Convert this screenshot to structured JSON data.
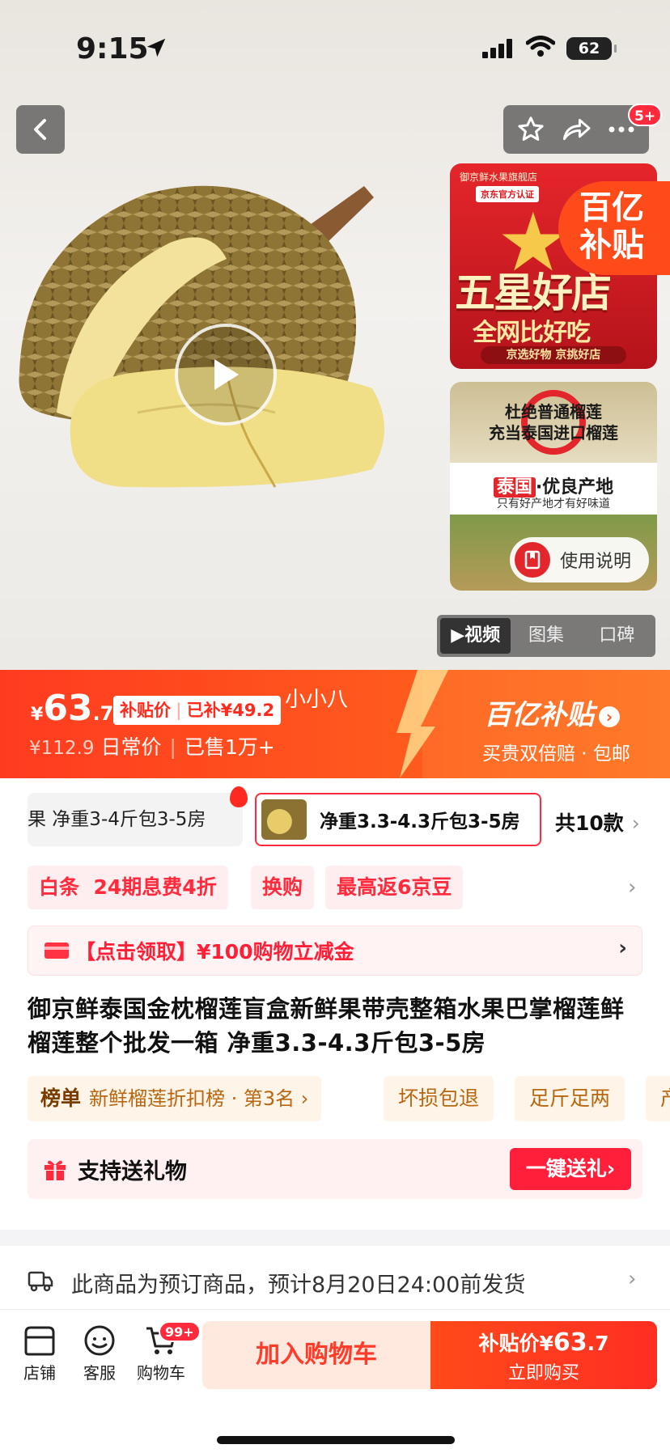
{
  "status_bar": {
    "time": "9:15",
    "battery": "62"
  },
  "top_actions": {
    "more_badge": "5+"
  },
  "promo_store": {
    "store_name": "御京鲜水果旗舰店",
    "cert": "京东官方认证",
    "headline": "五星好店",
    "subline": "全网比好吃",
    "bar": "京选好物 京挑好店"
  },
  "yibu_corner": {
    "line1": "百亿",
    "line2": "补贴"
  },
  "promo_origin": {
    "line1": "杜绝普通榴莲",
    "line2": "充当泰国进口榴莲",
    "country": "泰国",
    "origin": "·优良产地",
    "slogan": "只有好产地才有好味道"
  },
  "manual_label": "使用说明",
  "media_tabs": [
    "▶视频",
    "图集",
    "口碑"
  ],
  "price": {
    "currency": "¥",
    "integer": "63",
    "decimal": ".7",
    "tag_label": "补贴价",
    "tag_value": "已补¥49.2",
    "user_overlay": "小小八",
    "original": "¥112.9",
    "original_label": "日常价",
    "sold": "已售1万+",
    "program_name": "百亿补贴",
    "program_sub": "买贵双倍赔 · 包邮"
  },
  "variants": {
    "items": [
      "果 净重3-4斤包3-5房",
      "净重3.3-4.3斤包3-5房"
    ],
    "total": "共10款"
  },
  "chips": [
    {
      "label": "白条"
    },
    {
      "label": "24期息费4折"
    },
    {
      "label": "换购"
    },
    {
      "label": "最高返6京豆"
    }
  ],
  "coupon": {
    "text": "【点击领取】¥100购物立减金"
  },
  "product_title": "御京鲜泰国金枕榴莲盲盒新鲜果带壳整箱水果巴掌榴莲鲜榴莲整个批发一箱 净重3.3-4.3斤包3-5房",
  "ranking": {
    "label": "榜单",
    "text": "新鲜榴莲折扣榜 · 第3名 ›"
  },
  "service_tags": [
    "坏损包退",
    "足斤足两",
    "产"
  ],
  "gift": {
    "label": "支持送礼物",
    "button": "一键送礼›"
  },
  "shipping": {
    "text": "此商品为预订商品，预计8月20日24:00前发货"
  },
  "bottom_bar": {
    "nav": [
      "店铺",
      "客服",
      "购物车"
    ],
    "cart_badge": "99+",
    "add_to_cart": "加入购物车",
    "buy_price_label": "补贴价¥",
    "buy_price_int": "63",
    "buy_price_dec": ".7",
    "buy_now": "立即购买"
  },
  "colors": {
    "accent": "#ff2b3c",
    "banner": "#ff4a1e",
    "gold": "#b8660f"
  }
}
